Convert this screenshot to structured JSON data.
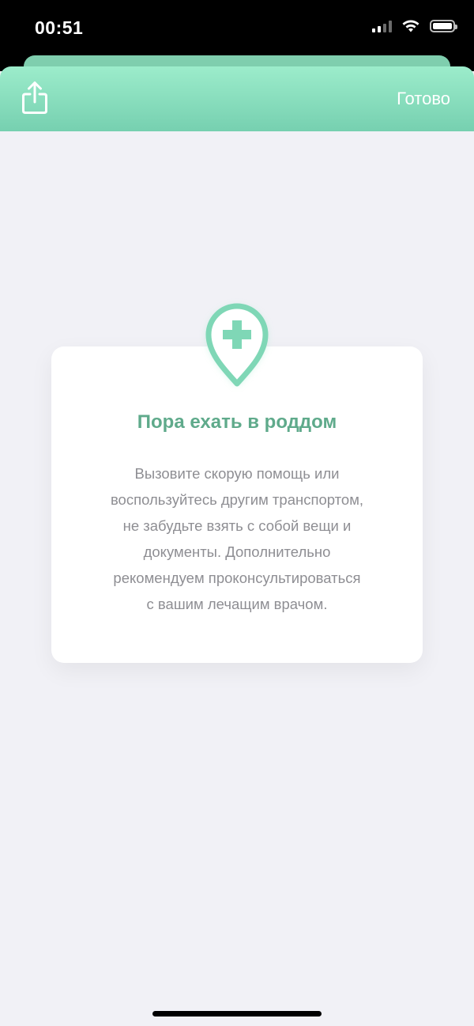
{
  "status_bar": {
    "time": "00:51",
    "icons": [
      "cellular-signal-icon",
      "wifi-icon",
      "battery-icon"
    ]
  },
  "header": {
    "share_icon": "share-icon",
    "done_label": "Готово"
  },
  "card": {
    "icon": "location-pin-medical-cross-icon",
    "title": "Пора ехать в роддом",
    "body_lines": [
      "Вызовите скорую помощь или",
      "воспользуйтесь другим транспортом,",
      "не забудьте взять с собой вещи и",
      "документы. Дополнительно",
      "рекомендуем проконсультироваться",
      "с вашим лечащим врачом."
    ]
  },
  "colors": {
    "accent": "#7fd7b6",
    "header_top": "#9ceccb",
    "header_bottom": "#76d0b0",
    "title": "#5faa8b",
    "body_text": "#8e8e93",
    "background": "#f1f1f6"
  }
}
